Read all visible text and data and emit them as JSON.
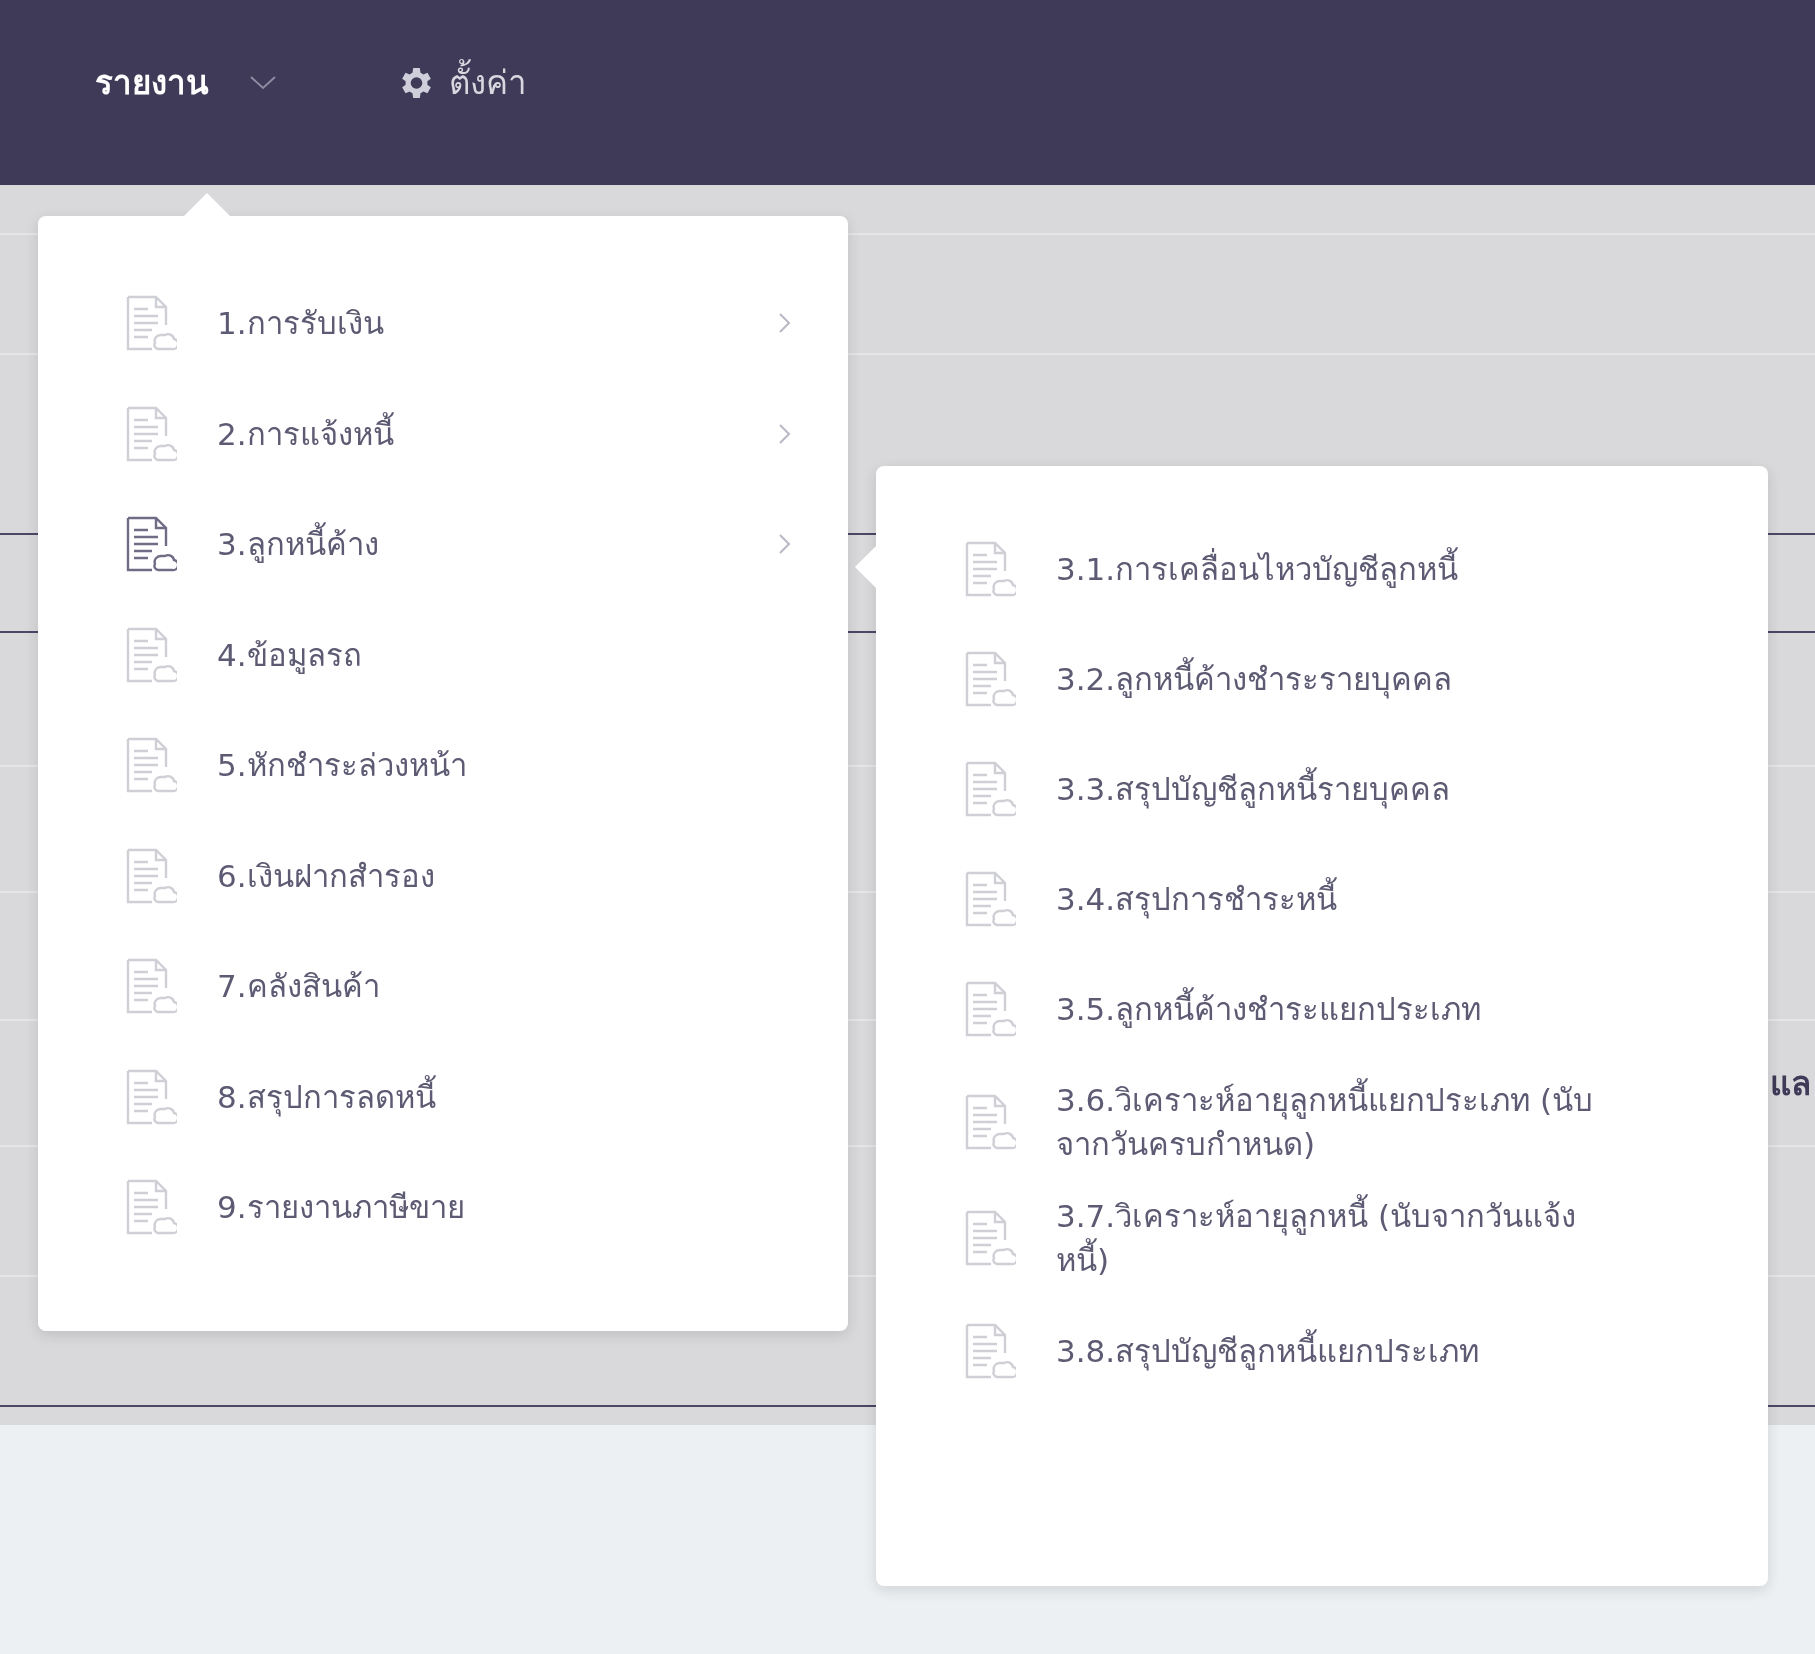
{
  "nav": [
    {
      "label": "รายงาน",
      "kind": "dropdown",
      "selected": true
    },
    {
      "label": "ตั้งค่า",
      "kind": "settings",
      "selected": false
    }
  ],
  "background": {
    "fragment": "แล"
  },
  "menu": {
    "items": [
      {
        "label": "1.การรับเงิน",
        "has_submenu": true,
        "selected": false
      },
      {
        "label": "2.การแจ้งหนี้",
        "has_submenu": true,
        "selected": false
      },
      {
        "label": "3.ลูกหนี้ค้าง",
        "has_submenu": true,
        "selected": true
      },
      {
        "label": "4.ข้อมูลรถ",
        "has_submenu": false,
        "selected": false
      },
      {
        "label": "5.หักชำระล่วงหน้า",
        "has_submenu": false,
        "selected": false
      },
      {
        "label": "6.เงินฝากสำรอง",
        "has_submenu": false,
        "selected": false
      },
      {
        "label": "7.คลังสินค้า",
        "has_submenu": false,
        "selected": false
      },
      {
        "label": "8.สรุปการลดหนี้",
        "has_submenu": false,
        "selected": false
      },
      {
        "label": "9.รายงานภาษีขาย",
        "has_submenu": false,
        "selected": false
      }
    ]
  },
  "submenu": {
    "items": [
      {
        "label": "3.1.การเคลื่อนไหวบัญชีลูกหนี้"
      },
      {
        "label": "3.2.ลูกหนี้ค้างชำระรายบุคคล"
      },
      {
        "label": "3.3.สรุปบัญชีลูกหนี้รายบุคคล"
      },
      {
        "label": "3.4.สรุปการชำระหนี้"
      },
      {
        "label": "3.5.ลูกหนี้ค้างชำระแยกประเภท"
      },
      {
        "label": "3.6.วิเคราะห์อายุลูกหนี้แยกประเภท (นับจากวันครบกำหนด)"
      },
      {
        "label": "3.7.วิเคราะห์อายุลูกหนี้ (นับจากวันแจ้งหนี้)"
      },
      {
        "label": "3.8.สรุปบัญชีลูกหนี้แยกประเภท"
      }
    ]
  }
}
